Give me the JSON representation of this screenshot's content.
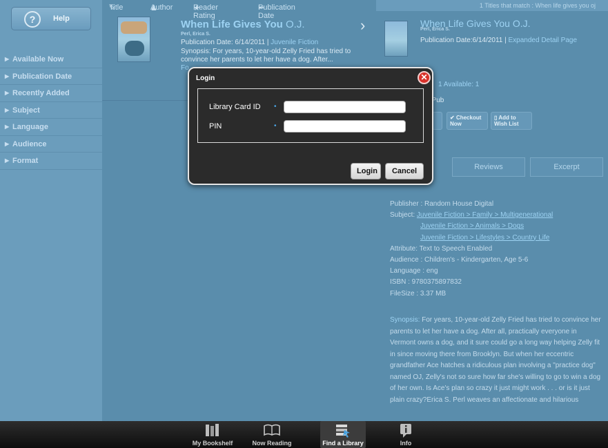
{
  "sidebar": {
    "help_label": "Help",
    "help_glyph": "?",
    "items": [
      {
        "label": "Available Now"
      },
      {
        "label": "Publication Date"
      },
      {
        "label": "Recently Added"
      },
      {
        "label": "Subject"
      },
      {
        "label": "Language"
      },
      {
        "label": "Audience"
      },
      {
        "label": "Format"
      }
    ]
  },
  "sortbar": {
    "title": "Title",
    "author": "Author",
    "rating": "Reader Rating",
    "pubdate": "Publication Date"
  },
  "book": {
    "title_bold": "When Life Gives You",
    "title_rest": " O.J.",
    "author": "Perl, Erica S.",
    "pub_prefix": "Publication Date: 6/14/2011 | ",
    "pub_link": "Juvenile Fiction",
    "synopsis": "Synopsis: For years, 10-year-old Zelly Fried has tried to convince her parents to let her have a dog. After...",
    "format_partial": "Fo"
  },
  "detail": {
    "match_text": "1 Titles that match : When life gives you oj",
    "title": "When Life Gives You O.J.",
    "author": "Perl, Erica S.",
    "pub_prefix": "Publication Date:6/14/2011 | ",
    "pub_link": "Expanded Detail Page",
    "availability": "1   Available: 1",
    "format": "ePub",
    "checkout_label": "Checkout Now",
    "wishlist_label": "Add to Wish List",
    "tabs": [
      "Reviews",
      "Excerpt"
    ],
    "publisher": "Publisher : Random House Digital",
    "subject_label": "Subject: ",
    "subjects": [
      "Juvenile Fiction > Family > Multigenerational",
      "Juvenile Fiction > Animals > Dogs",
      "Juvenile Fiction > Lifestyles > Country Life"
    ],
    "attribute": "Attribute: Text to Speech Enabled",
    "audience": "Audience : Children's - Kindergarten, Age 5-6",
    "language": "Language : eng",
    "isbn": "ISBN : 9780375897832",
    "filesize": "FileSize : 3.37 MB",
    "synopsis_label": "Synopsis:",
    "synopsis_text": " For years, 10-year-old Zelly Fried has tried to convince her parents to let her have a dog. After all, practically everyone in Vermont owns a dog, and it sure could go a long way helping Zelly fit in since moving there from Brooklyn. But when her eccentric grandfather Ace hatches a ridiculous plan involving a \"practice dog\" named OJ, Zelly's not so sure how far she's willing to go to win a dog of her own. Is Ace's plan so crazy it just might work . . . or is it just plain crazy?Erica S. Perl weaves an affectionate and hilarious"
  },
  "modal": {
    "title": "Login",
    "close_glyph": "✕",
    "card_label": "Library Card ID",
    "pin_label": "PIN",
    "card_value": "",
    "pin_value": "",
    "login_button": "Login",
    "cancel_button": "Cancel"
  },
  "tabbar": {
    "items": [
      {
        "label": "My Bookshelf"
      },
      {
        "label": "Now Reading"
      },
      {
        "label": "Find a Library"
      },
      {
        "label": "Info"
      }
    ],
    "active_index": 2
  },
  "colors": {
    "background": "#5d8fae",
    "link": "#9dd2f2",
    "modal_bg": "#2b2b2b",
    "close_red": "#d9322b"
  }
}
